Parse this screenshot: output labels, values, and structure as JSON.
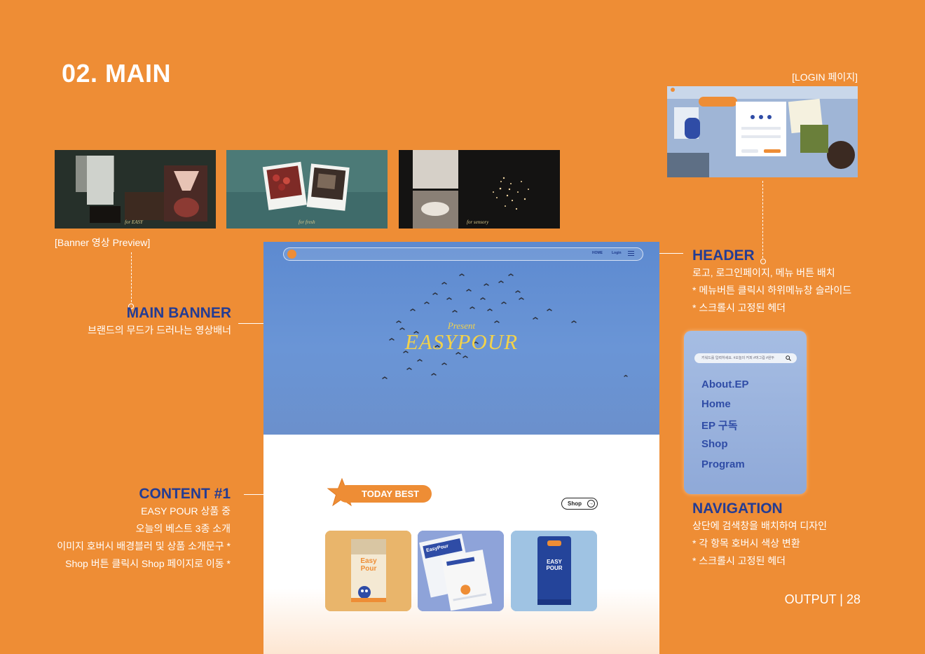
{
  "page": {
    "title": "02. MAIN",
    "footer": "OUTPUT | 28"
  },
  "previews": {
    "label": "[Banner 영상 Preview]",
    "captions": [
      "for EASY",
      "for fresh",
      "for sensory"
    ]
  },
  "login": {
    "label": "[LOGIN 페이지]"
  },
  "annotations": {
    "header": {
      "title": "HEADER",
      "lines": [
        "로고, 로그인페이지, 메뉴 버튼 배치",
        "* 메뉴버튼 클릭시 하위메뉴창 슬라이드",
        "* 스크롤시 고정된 헤더"
      ]
    },
    "main_banner": {
      "title": "MAIN BANNER",
      "lines": [
        "브랜드의 무드가 드러나는 영상배너"
      ]
    },
    "content1": {
      "title": "CONTENT #1",
      "lines": [
        "EASY POUR 상품 중",
        "오늘의 베스트 3종 소개",
        "이미지  호버시 배경블러 및 상품 소개문구 *",
        "Shop 버튼 클릭시 Shop 페이지로 이동 *"
      ]
    },
    "navigation": {
      "title": "NAVIGATION",
      "lines": [
        "상단에 검색창을 배치하여 디자인",
        "* 각 항목 호버시 색상 변환",
        "* 스크롤시 고정된 헤더"
      ]
    }
  },
  "mock": {
    "nav": {
      "home": "HOME",
      "login": "Login"
    },
    "hero": {
      "present": "Present",
      "title": "EASYPOUR"
    },
    "today_best": "TODAY BEST",
    "shop_button": "Shop",
    "products": [
      {
        "label": "Easy Pour",
        "bg": "#e9b56b"
      },
      {
        "label": "EasyPour",
        "bg": "#8ea3d9"
      },
      {
        "label": "EASY POUR",
        "bg": "#9fc3e3"
      }
    ]
  },
  "navpanel": {
    "search_placeholder": "키워드를 입력하세요.  #오늘의 커피 #머그컵 #원두",
    "items": [
      "About.EP",
      "Home",
      "EP 구독",
      "Shop",
      "Program"
    ]
  },
  "colors": {
    "background": "#ee8d35",
    "accent_blue": "#243c93",
    "hero_blue": "#6a95d6",
    "gold": "#f2d24b"
  }
}
